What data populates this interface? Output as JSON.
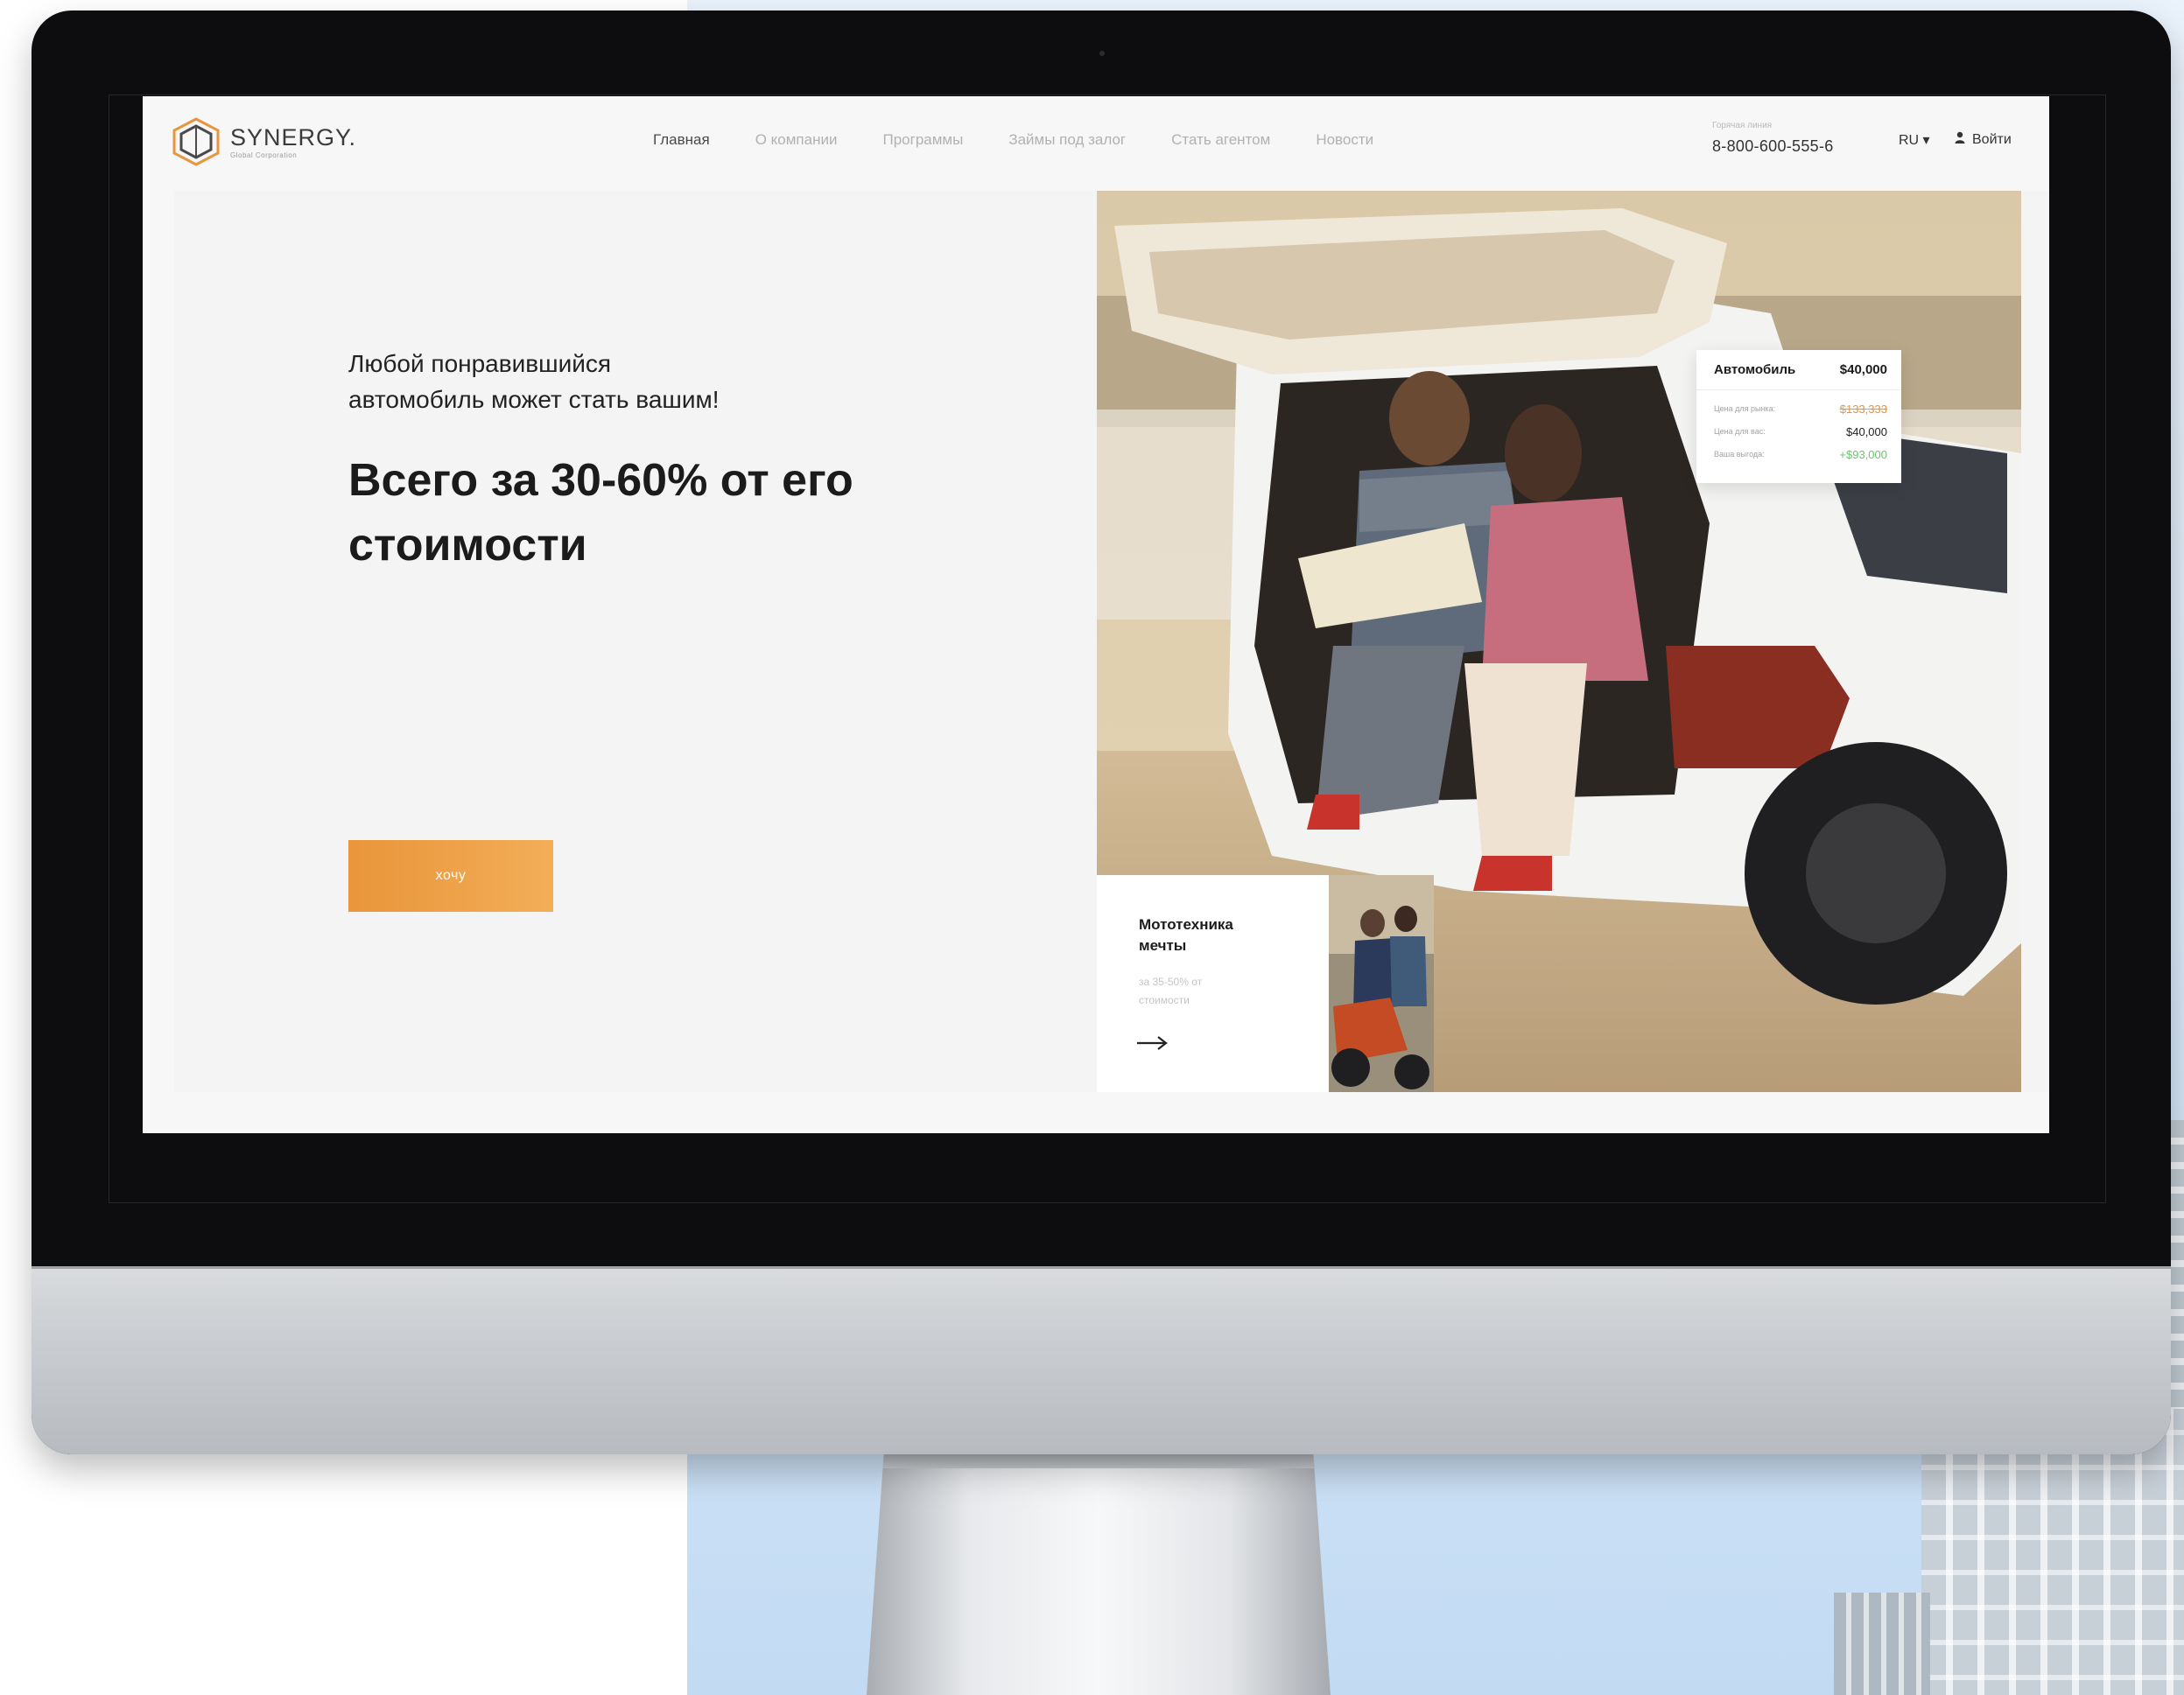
{
  "nav": {
    "items": [
      "Главная",
      "О компании",
      "Программы",
      "Займы под залог",
      "Стать агентом",
      "Новости"
    ],
    "active_index": 0
  },
  "logo": {
    "word": "SYNERGY.",
    "sub": "Global Corporation"
  },
  "header": {
    "hotline_label": "Горячая линия",
    "phone": "8-800-600-555-6",
    "language": "RU ▾",
    "login": "Войти"
  },
  "hero": {
    "subtitle_line1": "Любой понравившийся",
    "subtitle_line2": "автомобиль может стать вашим!",
    "headline_line1": "Всего за 30-60% от его",
    "headline_line2": "стоимости",
    "cta": "хочу"
  },
  "price_card": {
    "title": "Автомобиль",
    "price": "$40,000",
    "rows": [
      {
        "label": "Цена для рынка:",
        "value": "$133,333"
      },
      {
        "label": "Цена для вас:",
        "value": "$40,000"
      },
      {
        "label": "Ваша выгода:",
        "value": "+$93,000"
      }
    ]
  },
  "moto_card": {
    "title": "Мототехника мечты",
    "subtitle": "за 35-50% от стоимости"
  },
  "colors": {
    "accent": "#F0A04B",
    "accent_dark": "#E9953B",
    "strike": "#E8953F",
    "benefit": "#6BC46D",
    "frame": "#0D0D0F"
  },
  "icons": {
    "user": "user-icon",
    "arrow": "arrow-right-icon",
    "logo": "hexagon-logo-icon"
  }
}
